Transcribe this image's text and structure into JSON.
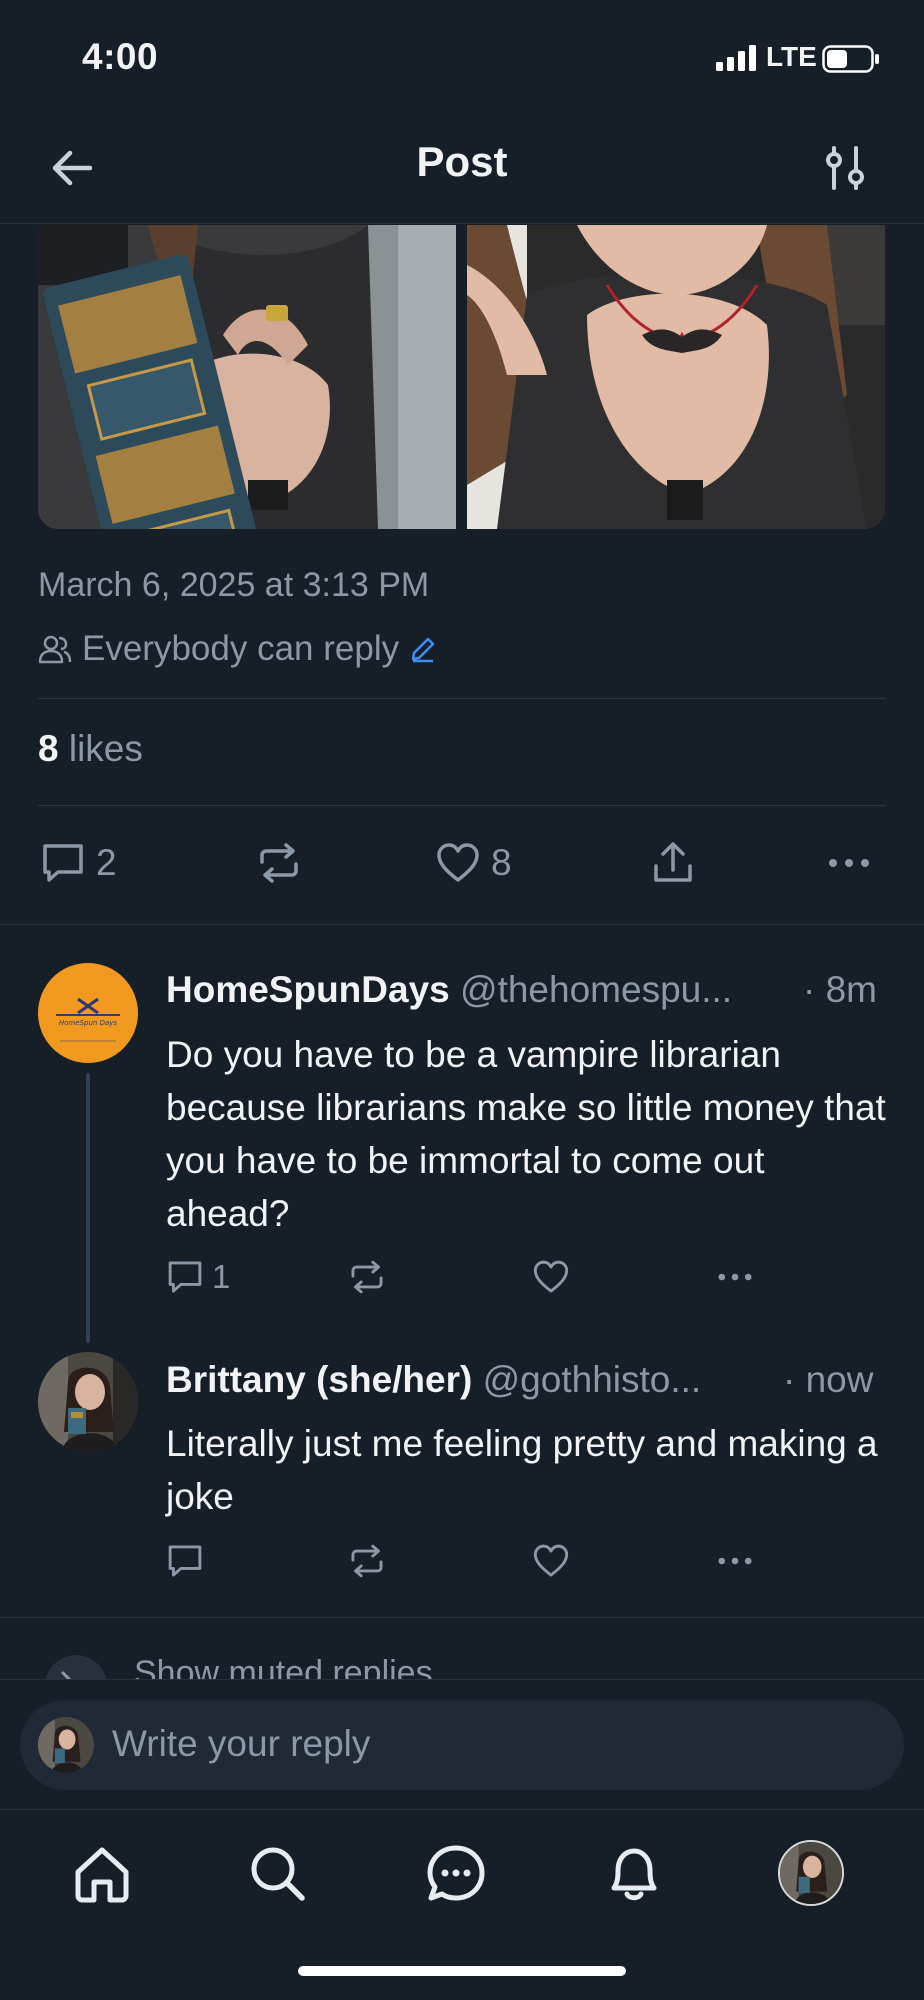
{
  "status_bar": {
    "time": "4:00",
    "network": "LTE"
  },
  "header": {
    "title": "Post"
  },
  "post": {
    "date": "March 6, 2025 at 3:13 PM",
    "reply_permission": "Everybody can reply",
    "likes_count": "8",
    "likes_label": "likes",
    "actions": {
      "replies": "2",
      "reposts": "",
      "likes": "8"
    }
  },
  "replies": [
    {
      "name": "HomeSpunDays",
      "handle": "@thehomespu...",
      "time": "· 8m",
      "text": "Do you have to be a vampire librarian because librarians make so little money that you have to be immortal to come out ahead?",
      "reply_count": "1",
      "avatar_text": "HomeSpun Days"
    },
    {
      "name": "Brittany (she/her)",
      "handle": "@gothhisto...",
      "time": "· now",
      "text": "Literally just me feeling pretty and making a joke",
      "reply_count": ""
    }
  ],
  "show_more": "Show muted replies",
  "composer": {
    "placeholder": "Write your reply"
  },
  "colors": {
    "background": "#161e27",
    "text": "#f1f3f5",
    "muted": "#8b98a5",
    "accent": "#3b8ff6",
    "divider": "#26313d"
  },
  "icons": {
    "back": "arrow-left-icon",
    "settings": "sliders-icon",
    "people": "people-icon",
    "edit": "pencil-icon",
    "reply": "speech-bubble-icon",
    "repost": "repost-icon",
    "like": "heart-icon",
    "share": "share-icon",
    "more": "ellipsis-icon",
    "tabs": [
      "home-icon",
      "search-icon",
      "chat-icon",
      "bell-icon",
      "profile-avatar"
    ]
  }
}
